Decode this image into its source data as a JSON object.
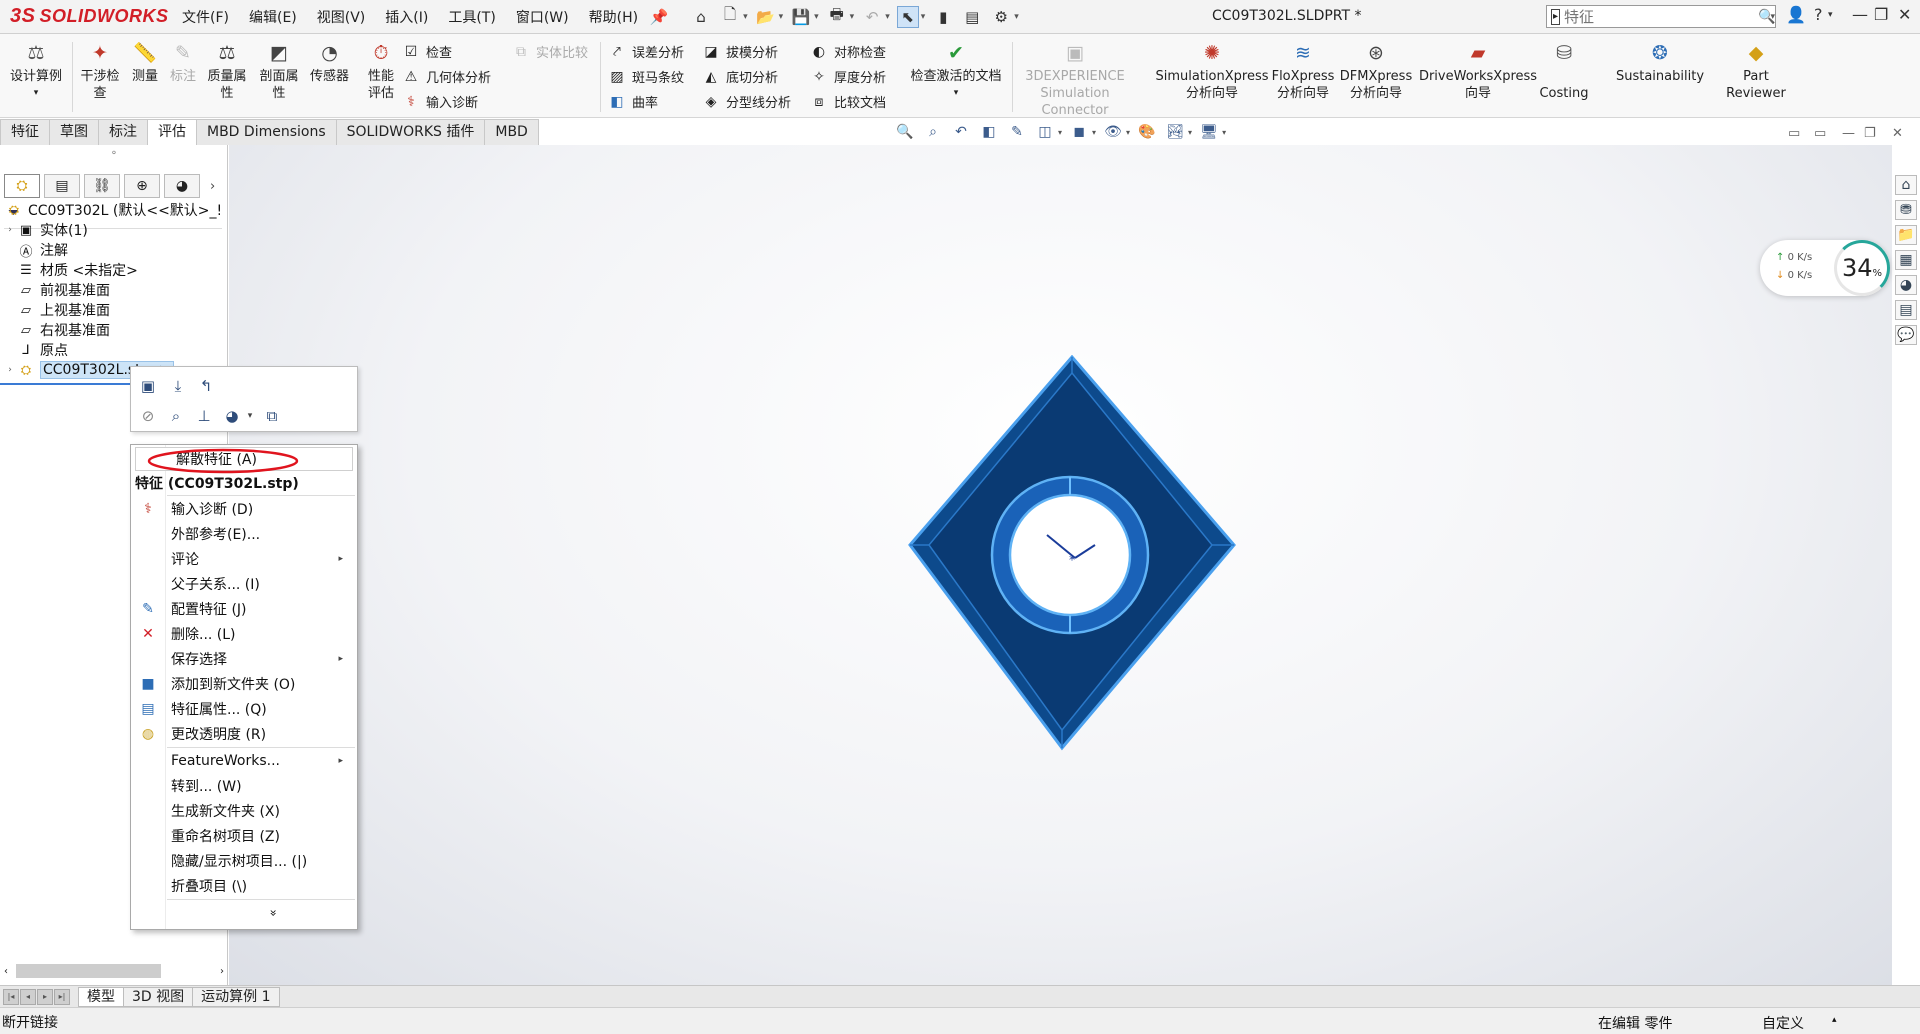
{
  "app": {
    "logo_text": "SOLIDWORKS",
    "logo_ds": "3S",
    "document_title": "CC09T302L.SLDPRT *",
    "accent_red": "#d21e27",
    "selection_blue": "#cde4f7"
  },
  "menubar": [
    "文件(F)",
    "编辑(E)",
    "视图(V)",
    "插入(I)",
    "工具(T)",
    "窗口(W)",
    "帮助(H)"
  ],
  "search": {
    "placeholder": "特征"
  },
  "commands": {
    "design_study": "设计算例",
    "interference": "干涉检查",
    "measure": "测量",
    "markup": "标注",
    "mass_props": "质量属性",
    "section_props": "剖面属性",
    "sensor": "传感器",
    "performance": "性能评估",
    "check": "检查",
    "geometry_analysis": "几何体分析",
    "import_diag": "输入诊断",
    "compare_disabled": "实体比较",
    "deviation": "误差分析",
    "zebra": "斑马条纹",
    "curvature": "曲率",
    "draft": "拔模分析",
    "undercut": "底切分析",
    "parting_line": "分型线分析",
    "symmetry": "对称检查",
    "thickness": "厚度分析",
    "compare_docs": "比较文档",
    "check_active": "检查激活的文档",
    "exp_connector_1": "3DEXPERIENCE",
    "exp_connector_2": "Simulation Connector",
    "simxpress_1": "SimulationXpress",
    "simxpress_2": "分析向导",
    "floxpress_1": "FloXpress",
    "floxpress_2": "分析向导",
    "dfmxpress_1": "DFMXpress",
    "dfmxpress_2": "分析向导",
    "driveworks_1": "DriveWorksXpress",
    "driveworks_2": "向导",
    "costing": "Costing",
    "sustainability": "Sustainability",
    "part_reviewer_1": "Part",
    "part_reviewer_2": "Reviewer"
  },
  "cm_tabs": [
    "特征",
    "草图",
    "标注",
    "评估",
    "MBD Dimensions",
    "SOLIDWORKS 插件",
    "MBD"
  ],
  "cm_active_tab": "评估",
  "feature_tree": {
    "root": "CC09T302L  (默认<<默认>_!",
    "items": [
      {
        "label": "实体(1)",
        "icon": "solid-bodies-folder-icon"
      },
      {
        "label": "注解",
        "icon": "annotations-icon"
      },
      {
        "label": "材质 <未指定>",
        "icon": "material-icon"
      },
      {
        "label": "前视基准面",
        "icon": "plane-icon"
      },
      {
        "label": "上视基准面",
        "icon": "plane-icon"
      },
      {
        "label": "右视基准面",
        "icon": "plane-icon"
      },
      {
        "label": "原点",
        "icon": "origin-icon"
      }
    ],
    "imported": "CC09T302L.stp ->"
  },
  "context_menu": {
    "dissolve": "解散特征 (A)",
    "header": "特征 (CC09T302L.stp)",
    "items": [
      {
        "label": "输入诊断 (D)",
        "icon": "import-diagnostics-icon"
      },
      {
        "label": "外部参考(E)...",
        "icon": ""
      },
      {
        "label": "评论",
        "icon": "",
        "submenu": true
      },
      {
        "label": "父子关系... (I)",
        "icon": ""
      },
      {
        "label": "配置特征 (J)",
        "icon": "configure-feature-icon"
      },
      {
        "label": "删除... (L)",
        "icon": "delete-icon"
      },
      {
        "label": "保存选择",
        "icon": "",
        "submenu": true
      },
      {
        "label": "添加到新文件夹 (O)",
        "icon": "folder-icon"
      },
      {
        "label": "特征属性... (Q)",
        "icon": "properties-icon"
      },
      {
        "label": "更改透明度 (R)",
        "icon": "transparency-icon"
      }
    ],
    "items2": [
      {
        "label": "FeatureWorks...",
        "submenu": true
      },
      {
        "label": "转到... (W)"
      },
      {
        "label": "生成新文件夹 (X)"
      },
      {
        "label": "重命名树项目 (Z)"
      },
      {
        "label": "隐藏/显示树项目... (|)"
      },
      {
        "label": "折叠项目 (\\)"
      }
    ],
    "more": "»"
  },
  "net_widget": {
    "upload": "0  K/s",
    "download": "0  K/s",
    "percent": "34",
    "unit": "%"
  },
  "bottom_tabs": [
    "模型",
    "3D 视图",
    "运动算例 1"
  ],
  "status": {
    "left": "断开链接",
    "editing": "在编辑 零件",
    "custom": "自定义"
  },
  "part_color": "#0b3a73"
}
